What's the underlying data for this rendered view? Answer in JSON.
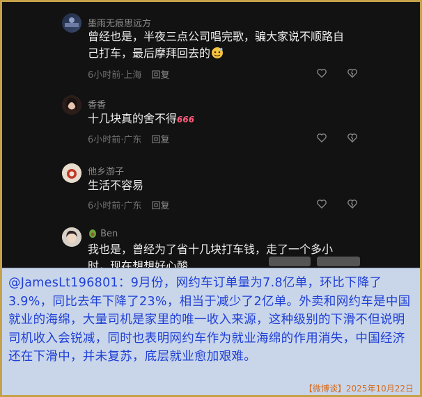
{
  "comments": [
    {
      "username": "墨雨无痕思远方",
      "lines": [
        "曾经也是，半夜三点公司唱完歌，骗大家说不顺路自",
        "己打车，最后摩拜回去的"
      ],
      "time": "6小时前",
      "location": "上海",
      "reply": "回复",
      "emoji": "sweat-smile-emoji"
    },
    {
      "username": "香香",
      "lines": [
        "十几块真的舍不得"
      ],
      "badge": "666",
      "time": "6小时前",
      "location": "广东",
      "reply": "回复"
    },
    {
      "username": "他乡游子",
      "lines": [
        "生活不容易"
      ],
      "time": "6小时前",
      "location": "广东",
      "reply": "回复"
    },
    {
      "username": "Ben",
      "lines": [
        "我也是，曾经为了省十几块打车钱，走了一个多小",
        "时，现在想想好心酸"
      ],
      "username_icon": "avocado-icon"
    }
  ],
  "caption": {
    "text": "@JamesLt196801：9月份，网约车订单量为7.8亿单，环比下降了3.9%，同比去年下降了23%，相当于减少了2亿单。外卖和网约车是中国就业的海绵，大量司机是家里的唯一收入来源，这种级别的下滑不但说明司机收入会锐减，同时也表明网约车作为就业海绵的作用消失，中国经济还在下滑中，并未复苏，底层就业愈加艰难。",
    "source": "【微博谈】2025年10月22日"
  },
  "colors": {
    "frame_border": "#c5a24a",
    "caption_bg": "#c9d6ea",
    "caption_text": "#1f3fd6",
    "source_text": "#d66b1a"
  }
}
